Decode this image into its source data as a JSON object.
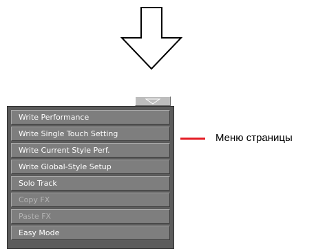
{
  "illustration": {
    "arrow_icon": "down-arrow-icon"
  },
  "page_menu": {
    "tab_icon": "dropdown-triangle-icon",
    "items": [
      {
        "label": "Write Performance",
        "enabled": true
      },
      {
        "label": "Write Single Touch Setting",
        "enabled": true
      },
      {
        "label": "Write Current Style Perf.",
        "enabled": true
      },
      {
        "label": "Write Global-Style Setup",
        "enabled": true
      },
      {
        "label": "Solo Track",
        "enabled": true
      },
      {
        "label": "Copy FX",
        "enabled": false
      },
      {
        "label": "Paste FX",
        "enabled": false
      },
      {
        "label": "Easy Mode",
        "enabled": true
      }
    ]
  },
  "callout": {
    "label": "Меню страницы",
    "line_color": "#e41b23"
  }
}
